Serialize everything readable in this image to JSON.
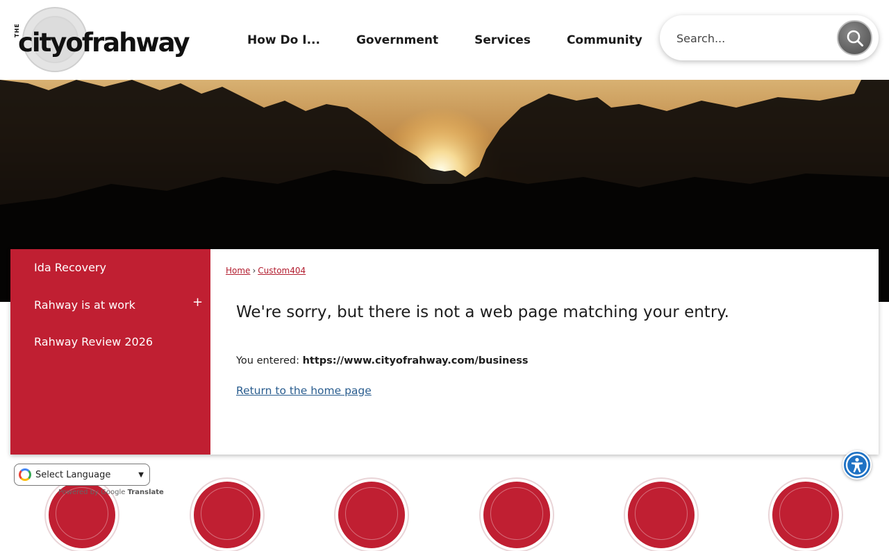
{
  "header": {
    "logo_text": "cityofrahway",
    "logo_prefix": "THE",
    "nav": [
      "How Do I...",
      "Government",
      "Services",
      "Community"
    ],
    "search_placeholder": "Search..."
  },
  "sidebar": {
    "items": [
      {
        "label": "Ida Recovery",
        "expandable": false
      },
      {
        "label": "Rahway is at work",
        "expandable": true,
        "toggle": "+"
      },
      {
        "label": "Rahway Review 2026",
        "expandable": false
      }
    ]
  },
  "breadcrumb": {
    "home": "Home",
    "separator": "›",
    "current": "Custom404"
  },
  "main": {
    "heading": "We're sorry, but there is not a web page matching your entry.",
    "entered_label": "You entered:",
    "entered_url": "https://www.cityofrahway.com/business",
    "return_link": "Return to the home page"
  },
  "translate": {
    "select_label": "Select Language",
    "powered_by": "Powered by",
    "google": "Google",
    "translate": "Translate"
  },
  "colors": {
    "brand_red": "#c01f32",
    "link_blue": "#2a5d8f",
    "accessibility_blue": "#1f72c4"
  },
  "icons": {
    "search": "search-icon",
    "accessibility": "accessibility-icon"
  }
}
